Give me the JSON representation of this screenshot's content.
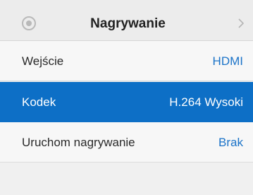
{
  "header": {
    "icon": "record-icon",
    "title": "Nagrywanie",
    "chevron": "chevron-right-icon"
  },
  "rows": [
    {
      "label": "Wejście",
      "value": "HDMI",
      "selected": false
    },
    {
      "label": "Kodek",
      "value": "H.264 Wysoki",
      "selected": true
    },
    {
      "label": "Uruchom nagrywanie",
      "value": "Brak",
      "selected": false
    }
  ],
  "colors": {
    "accent": "#0d6fc6",
    "value_text": "#1b73c8",
    "background": "#f0f0f0"
  }
}
